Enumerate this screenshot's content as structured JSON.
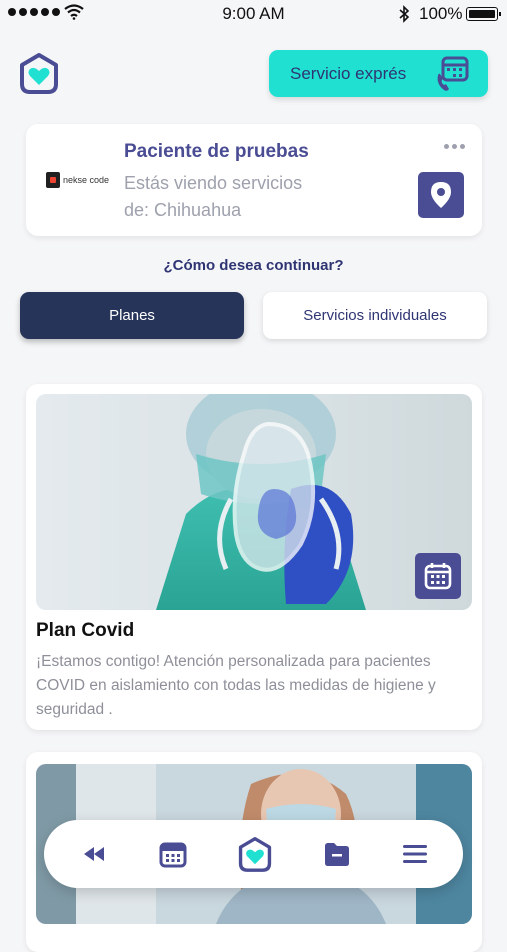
{
  "status_bar": {
    "time": "9:00 AM",
    "battery": "100%"
  },
  "header": {
    "express_label": "Servicio exprés"
  },
  "patient": {
    "name": "Paciente de pruebas",
    "location_line1": "Estás viendo servicios",
    "location_line2": "de: Chihuahua",
    "brand": "nekse code"
  },
  "prompt": "¿Cómo desea continuar?",
  "tabs": {
    "plans": "Planes",
    "individual": "Servicios individuales"
  },
  "plans": [
    {
      "title": "Plan Covid",
      "description": "¡Estamos contigo! Atención personalizada para pacientes COVID en aislamiento con todas las medidas de higiene y seguridad ."
    }
  ],
  "colors": {
    "accent": "#20e0d2",
    "primary": "#4a4c94",
    "dark_tab": "#273459"
  },
  "icons": {
    "nav": [
      "rewind-icon",
      "calendar-icon",
      "home-logo-icon",
      "folder-icon",
      "menu-icon"
    ]
  }
}
